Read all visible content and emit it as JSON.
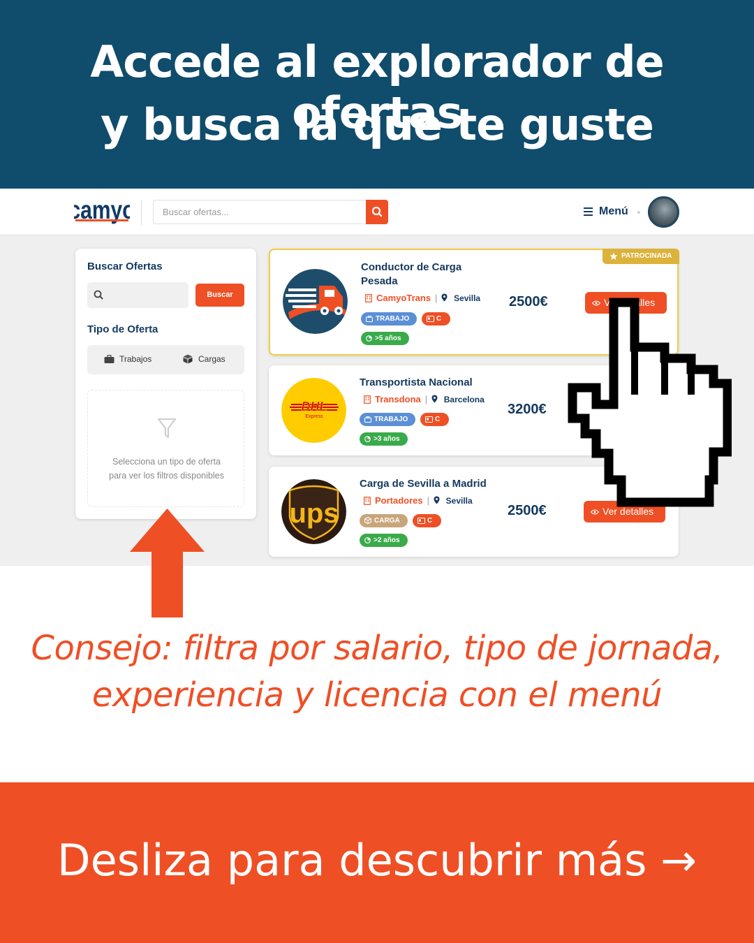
{
  "banner": {
    "line1": "Accede al explorador de ofertas",
    "line2": "y busca la que te guste"
  },
  "app": {
    "logo_text": "camyo",
    "search_placeholder": "Buscar ofertas...",
    "menu_label": "Menú"
  },
  "sidebar": {
    "title": "Buscar Ofertas",
    "search_button": "Buscar",
    "type_title": "Tipo de Oferta",
    "types": [
      {
        "label": "Trabajos",
        "icon": "briefcase-icon"
      },
      {
        "label": "Cargas",
        "icon": "box-icon"
      }
    ],
    "empty_line1": "Selecciona un tipo de oferta",
    "empty_line2": "para ver los filtros disponibles"
  },
  "offers": [
    {
      "title_line1": "Conductor de Carga",
      "title_line2": "Pesada",
      "company": "CamyoTrans",
      "location": "Sevilla",
      "type_tag": "TRABAJO",
      "license_tag": "C",
      "experience_tag": ">5 años",
      "price": "2500€",
      "button": "Ver detalles",
      "sponsored_label": "PATROCINADA",
      "logo": "camyo-truck-logo"
    },
    {
      "title_line1": "Transportista Nacional",
      "company": "Transdona",
      "location": "Barcelona",
      "type_tag": "TRABAJO",
      "license_tag": "C",
      "experience_tag": ">3 años",
      "price": "3200€",
      "logo": "dhl-logo",
      "logo_text": "DHL",
      "logo_subtext": "Express"
    },
    {
      "title_line1": "Carga de Sevilla a Madrid",
      "company": "Portadores",
      "location": "Sevilla",
      "type_tag": "CARGA",
      "license_tag": "C",
      "experience_tag": ">2 años",
      "price": "2500€",
      "button": "Ver detalles",
      "logo": "ups-logo",
      "logo_text": "ups"
    }
  ],
  "tip": {
    "line1": "Consejo: filtra por salario, tipo de jornada,",
    "line2": "experiencia y licencia con el menú"
  },
  "cta": "Desliza para descubrir más →",
  "colors": {
    "navy": "#104c6b",
    "orange": "#ef4f25",
    "dark_blue_text": "#14395f",
    "tag_blue": "#5b8fd6",
    "tag_green": "#3aaa4a",
    "tag_tan": "#c9a57b",
    "sponsored_gold": "#dcb23a"
  }
}
